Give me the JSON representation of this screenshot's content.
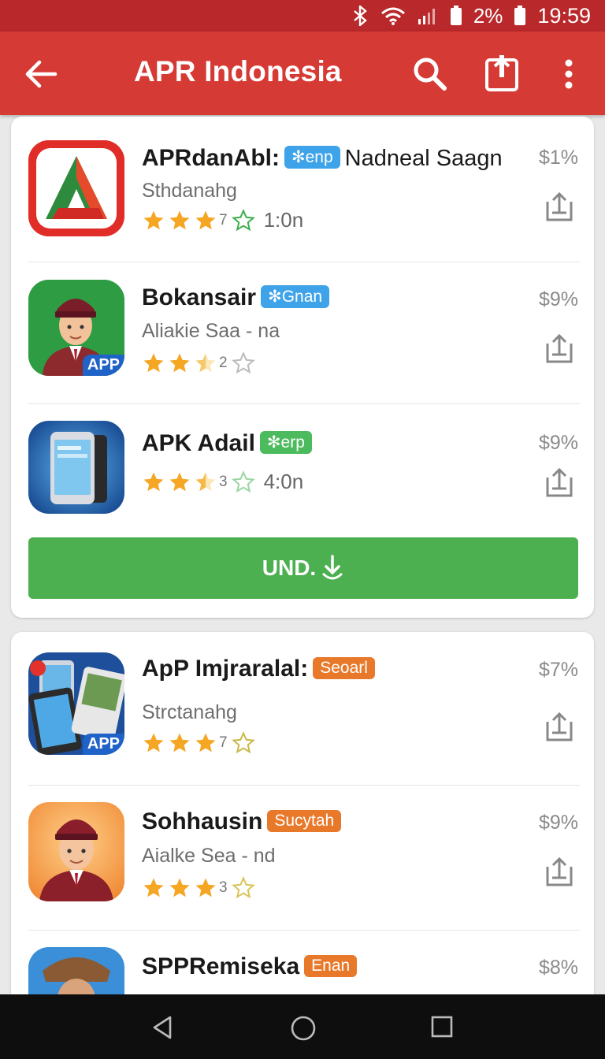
{
  "status": {
    "percent": "2%",
    "time": "19:59"
  },
  "appbar": {
    "title": "APR Indonesia"
  },
  "apps": [
    {
      "name": "APRdanAbl:",
      "badge": "enp",
      "name_extra": "Nadneal Saagn",
      "subtitle": "Sthdanahg",
      "rating_num": "7",
      "rating_text": "1:0n",
      "price": "$1%",
      "stars_filled": 3,
      "stars_total": 4
    },
    {
      "name": "Bokansair",
      "badge": "Gnan",
      "subtitle": "Aliakie Saa - na",
      "rating_num": "2",
      "rating_text": "",
      "price": "$9%",
      "stars_filled": 2.5,
      "stars_total": 4,
      "icon_label": "APP"
    },
    {
      "name": "APK Adail",
      "badge": "erp",
      "subtitle": "",
      "rating_num": "3",
      "rating_text": "4:0n",
      "price": "$9%",
      "stars_filled": 2.5,
      "stars_total": 4
    },
    {
      "name": "ApP Imjraralal:",
      "badge": "Seoarl",
      "subtitle": "Strctanahg",
      "rating_num": "7",
      "rating_text": "",
      "price": "$7%",
      "stars_filled": 3,
      "stars_total": 4,
      "icon_label": "APP"
    },
    {
      "name": "Sohhausin",
      "badge": "Sucytah",
      "subtitle": "Aialke Sea - nd",
      "rating_num": "3",
      "rating_text": "",
      "price": "$9%",
      "stars_filled": 3,
      "stars_total": 4
    },
    {
      "name": "SPPRemiseka",
      "badge": "Enan",
      "subtitle": "",
      "rating_num": "",
      "rating_text": "",
      "price": "$8%",
      "stars_filled": 0,
      "stars_total": 0
    }
  ],
  "install_button": {
    "label": "UND."
  },
  "colors": {
    "appbar": "#d63a35",
    "statusbar": "#b9282a",
    "button": "#4caf50",
    "star": "#f5a623"
  }
}
